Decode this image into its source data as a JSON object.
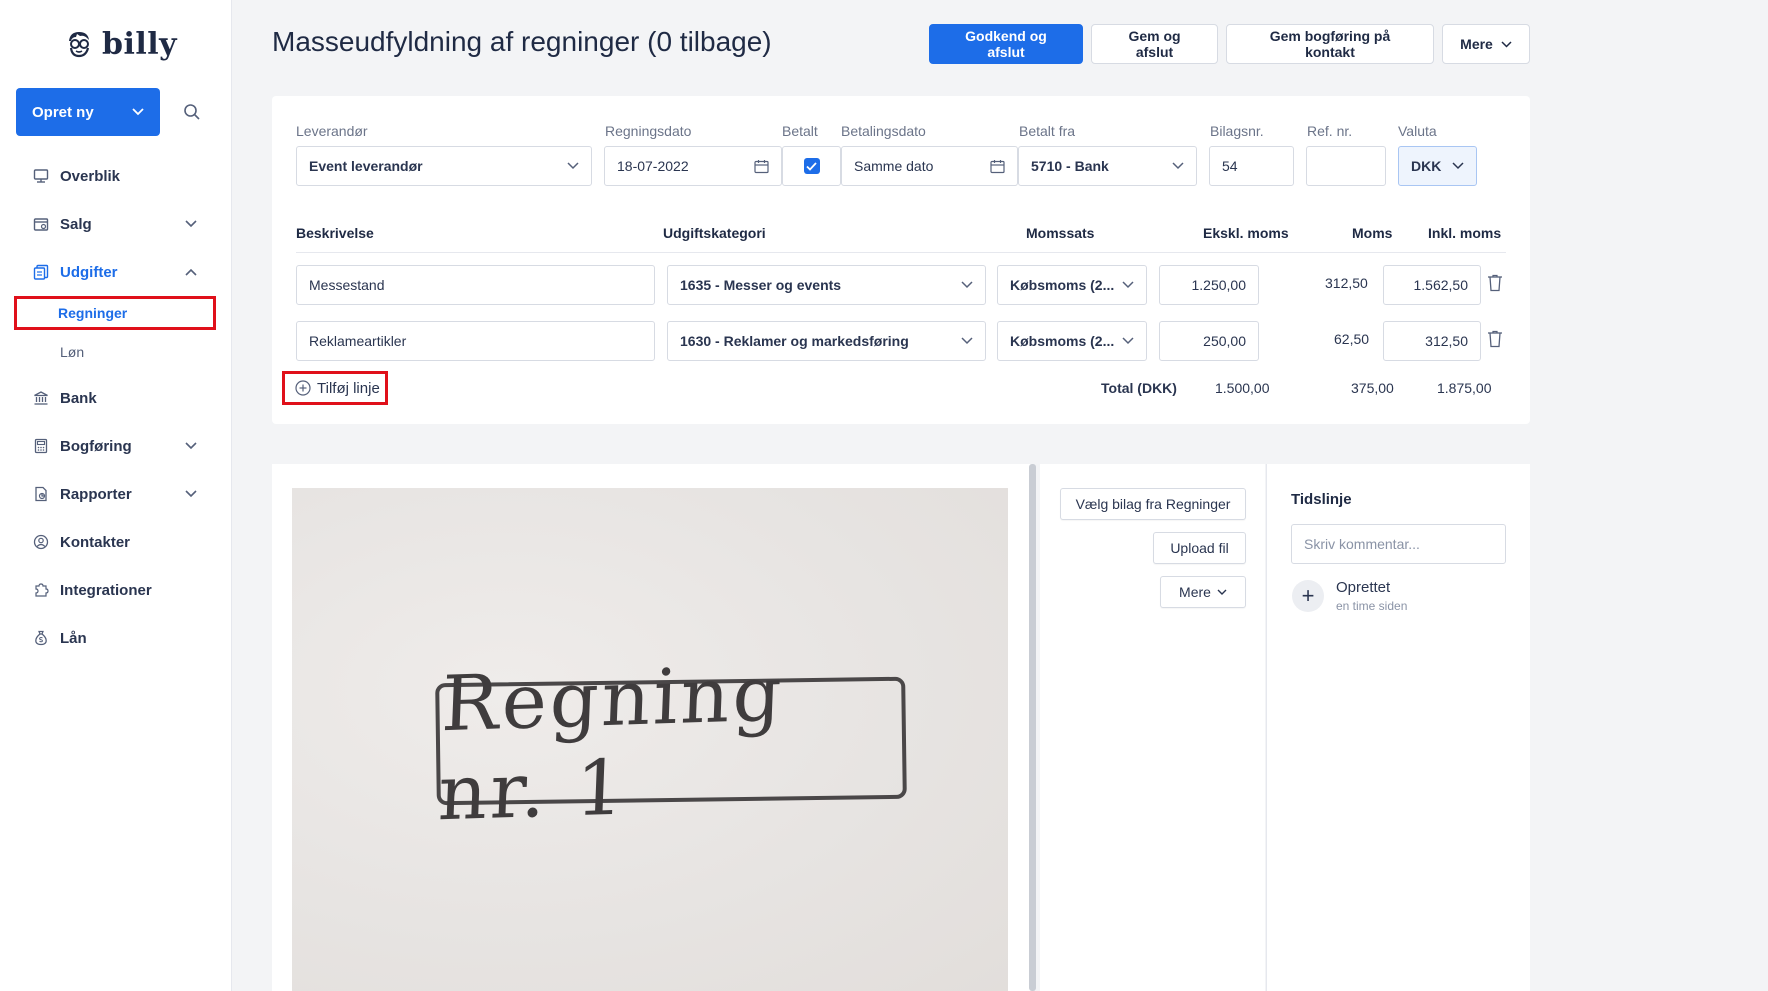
{
  "sidebar": {
    "logo_text": "billy",
    "create_label": "Opret ny",
    "nav": [
      {
        "label": "Overblik"
      },
      {
        "label": "Salg"
      },
      {
        "label": "Udgifter"
      },
      {
        "label": "Regninger"
      },
      {
        "label": "Løn"
      },
      {
        "label": "Bank"
      },
      {
        "label": "Bogføring"
      },
      {
        "label": "Rapporter"
      },
      {
        "label": "Kontakter"
      },
      {
        "label": "Integrationer"
      },
      {
        "label": "Lån"
      }
    ]
  },
  "header": {
    "title": "Masseudfyldning af regninger (0 tilbage)",
    "approve_label": "Godkend og afslut",
    "save_label": "Gem og afslut",
    "save_contact_label": "Gem bogføring på kontakt",
    "more_label": "Mere"
  },
  "bill": {
    "labels": {
      "vendor": "Leverandør",
      "date": "Regningsdato",
      "paid": "Betalt",
      "pay_date": "Betalingsdato",
      "paid_from": "Betalt fra",
      "voucher": "Bilagsnr.",
      "ref": "Ref. nr.",
      "currency": "Valuta"
    },
    "vendor": "Event leverandør",
    "date": "18-07-2022",
    "paid": true,
    "pay_date": "Samme dato",
    "paid_from": "5710 - Bank",
    "voucher": "54",
    "ref": "",
    "currency": "DKK"
  },
  "lines": {
    "headers": {
      "description": "Beskrivelse",
      "category": "Udgiftskategori",
      "vat_rate": "Momssats",
      "excl": "Ekskl. moms",
      "vat": "Moms",
      "incl": "Inkl. moms"
    },
    "rows": [
      {
        "description": "Messestand",
        "category": "1635 - Messer og events",
        "vat_rate": "Købsmoms (2...",
        "excl": "1.250,00",
        "vat": "312,50",
        "incl": "1.562,50"
      },
      {
        "description": "Reklameartikler",
        "category": "1630 - Reklamer og markedsføring",
        "vat_rate": "Købsmoms (2...",
        "excl": "250,00",
        "vat": "62,50",
        "incl": "312,50"
      }
    ],
    "add_line_label": "Tilføj linje",
    "total_label": "Total (DKK)",
    "total_excl": "1.500,00",
    "total_vat": "375,00",
    "total_incl": "1.875,00"
  },
  "attachment": {
    "handwritten_text": "Regning nr. 1",
    "select_label": "Vælg bilag fra Regninger",
    "upload_label": "Upload fil",
    "more_label": "Mere"
  },
  "timeline": {
    "title": "Tidslinje",
    "comment_placeholder": "Skriv kommentar...",
    "event": "Oprettet",
    "event_time": "en time siden"
  },
  "colors": {
    "primary": "#1d6de8",
    "highlight": "#e0101a",
    "text": "#1f2a44"
  }
}
